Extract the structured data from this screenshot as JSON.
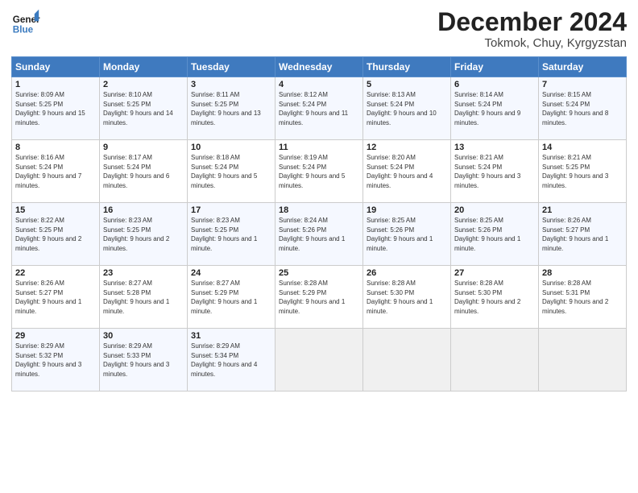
{
  "header": {
    "logo_general": "General",
    "logo_blue": "Blue",
    "month_title": "December 2024",
    "location": "Tokmok, Chuy, Kyrgyzstan"
  },
  "days_of_week": [
    "Sunday",
    "Monday",
    "Tuesday",
    "Wednesday",
    "Thursday",
    "Friday",
    "Saturday"
  ],
  "weeks": [
    [
      {
        "day": "1",
        "sunrise": "Sunrise: 8:09 AM",
        "sunset": "Sunset: 5:25 PM",
        "daylight": "Daylight: 9 hours and 15 minutes."
      },
      {
        "day": "2",
        "sunrise": "Sunrise: 8:10 AM",
        "sunset": "Sunset: 5:25 PM",
        "daylight": "Daylight: 9 hours and 14 minutes."
      },
      {
        "day": "3",
        "sunrise": "Sunrise: 8:11 AM",
        "sunset": "Sunset: 5:25 PM",
        "daylight": "Daylight: 9 hours and 13 minutes."
      },
      {
        "day": "4",
        "sunrise": "Sunrise: 8:12 AM",
        "sunset": "Sunset: 5:24 PM",
        "daylight": "Daylight: 9 hours and 11 minutes."
      },
      {
        "day": "5",
        "sunrise": "Sunrise: 8:13 AM",
        "sunset": "Sunset: 5:24 PM",
        "daylight": "Daylight: 9 hours and 10 minutes."
      },
      {
        "day": "6",
        "sunrise": "Sunrise: 8:14 AM",
        "sunset": "Sunset: 5:24 PM",
        "daylight": "Daylight: 9 hours and 9 minutes."
      },
      {
        "day": "7",
        "sunrise": "Sunrise: 8:15 AM",
        "sunset": "Sunset: 5:24 PM",
        "daylight": "Daylight: 9 hours and 8 minutes."
      }
    ],
    [
      {
        "day": "8",
        "sunrise": "Sunrise: 8:16 AM",
        "sunset": "Sunset: 5:24 PM",
        "daylight": "Daylight: 9 hours and 7 minutes."
      },
      {
        "day": "9",
        "sunrise": "Sunrise: 8:17 AM",
        "sunset": "Sunset: 5:24 PM",
        "daylight": "Daylight: 9 hours and 6 minutes."
      },
      {
        "day": "10",
        "sunrise": "Sunrise: 8:18 AM",
        "sunset": "Sunset: 5:24 PM",
        "daylight": "Daylight: 9 hours and 5 minutes."
      },
      {
        "day": "11",
        "sunrise": "Sunrise: 8:19 AM",
        "sunset": "Sunset: 5:24 PM",
        "daylight": "Daylight: 9 hours and 5 minutes."
      },
      {
        "day": "12",
        "sunrise": "Sunrise: 8:20 AM",
        "sunset": "Sunset: 5:24 PM",
        "daylight": "Daylight: 9 hours and 4 minutes."
      },
      {
        "day": "13",
        "sunrise": "Sunrise: 8:21 AM",
        "sunset": "Sunset: 5:24 PM",
        "daylight": "Daylight: 9 hours and 3 minutes."
      },
      {
        "day": "14",
        "sunrise": "Sunrise: 8:21 AM",
        "sunset": "Sunset: 5:25 PM",
        "daylight": "Daylight: 9 hours and 3 minutes."
      }
    ],
    [
      {
        "day": "15",
        "sunrise": "Sunrise: 8:22 AM",
        "sunset": "Sunset: 5:25 PM",
        "daylight": "Daylight: 9 hours and 2 minutes."
      },
      {
        "day": "16",
        "sunrise": "Sunrise: 8:23 AM",
        "sunset": "Sunset: 5:25 PM",
        "daylight": "Daylight: 9 hours and 2 minutes."
      },
      {
        "day": "17",
        "sunrise": "Sunrise: 8:23 AM",
        "sunset": "Sunset: 5:25 PM",
        "daylight": "Daylight: 9 hours and 1 minute."
      },
      {
        "day": "18",
        "sunrise": "Sunrise: 8:24 AM",
        "sunset": "Sunset: 5:26 PM",
        "daylight": "Daylight: 9 hours and 1 minute."
      },
      {
        "day": "19",
        "sunrise": "Sunrise: 8:25 AM",
        "sunset": "Sunset: 5:26 PM",
        "daylight": "Daylight: 9 hours and 1 minute."
      },
      {
        "day": "20",
        "sunrise": "Sunrise: 8:25 AM",
        "sunset": "Sunset: 5:26 PM",
        "daylight": "Daylight: 9 hours and 1 minute."
      },
      {
        "day": "21",
        "sunrise": "Sunrise: 8:26 AM",
        "sunset": "Sunset: 5:27 PM",
        "daylight": "Daylight: 9 hours and 1 minute."
      }
    ],
    [
      {
        "day": "22",
        "sunrise": "Sunrise: 8:26 AM",
        "sunset": "Sunset: 5:27 PM",
        "daylight": "Daylight: 9 hours and 1 minute."
      },
      {
        "day": "23",
        "sunrise": "Sunrise: 8:27 AM",
        "sunset": "Sunset: 5:28 PM",
        "daylight": "Daylight: 9 hours and 1 minute."
      },
      {
        "day": "24",
        "sunrise": "Sunrise: 8:27 AM",
        "sunset": "Sunset: 5:29 PM",
        "daylight": "Daylight: 9 hours and 1 minute."
      },
      {
        "day": "25",
        "sunrise": "Sunrise: 8:28 AM",
        "sunset": "Sunset: 5:29 PM",
        "daylight": "Daylight: 9 hours and 1 minute."
      },
      {
        "day": "26",
        "sunrise": "Sunrise: 8:28 AM",
        "sunset": "Sunset: 5:30 PM",
        "daylight": "Daylight: 9 hours and 1 minute."
      },
      {
        "day": "27",
        "sunrise": "Sunrise: 8:28 AM",
        "sunset": "Sunset: 5:30 PM",
        "daylight": "Daylight: 9 hours and 2 minutes."
      },
      {
        "day": "28",
        "sunrise": "Sunrise: 8:28 AM",
        "sunset": "Sunset: 5:31 PM",
        "daylight": "Daylight: 9 hours and 2 minutes."
      }
    ],
    [
      {
        "day": "29",
        "sunrise": "Sunrise: 8:29 AM",
        "sunset": "Sunset: 5:32 PM",
        "daylight": "Daylight: 9 hours and 3 minutes."
      },
      {
        "day": "30",
        "sunrise": "Sunrise: 8:29 AM",
        "sunset": "Sunset: 5:33 PM",
        "daylight": "Daylight: 9 hours and 3 minutes."
      },
      {
        "day": "31",
        "sunrise": "Sunrise: 8:29 AM",
        "sunset": "Sunset: 5:34 PM",
        "daylight": "Daylight: 9 hours and 4 minutes."
      },
      null,
      null,
      null,
      null
    ]
  ]
}
